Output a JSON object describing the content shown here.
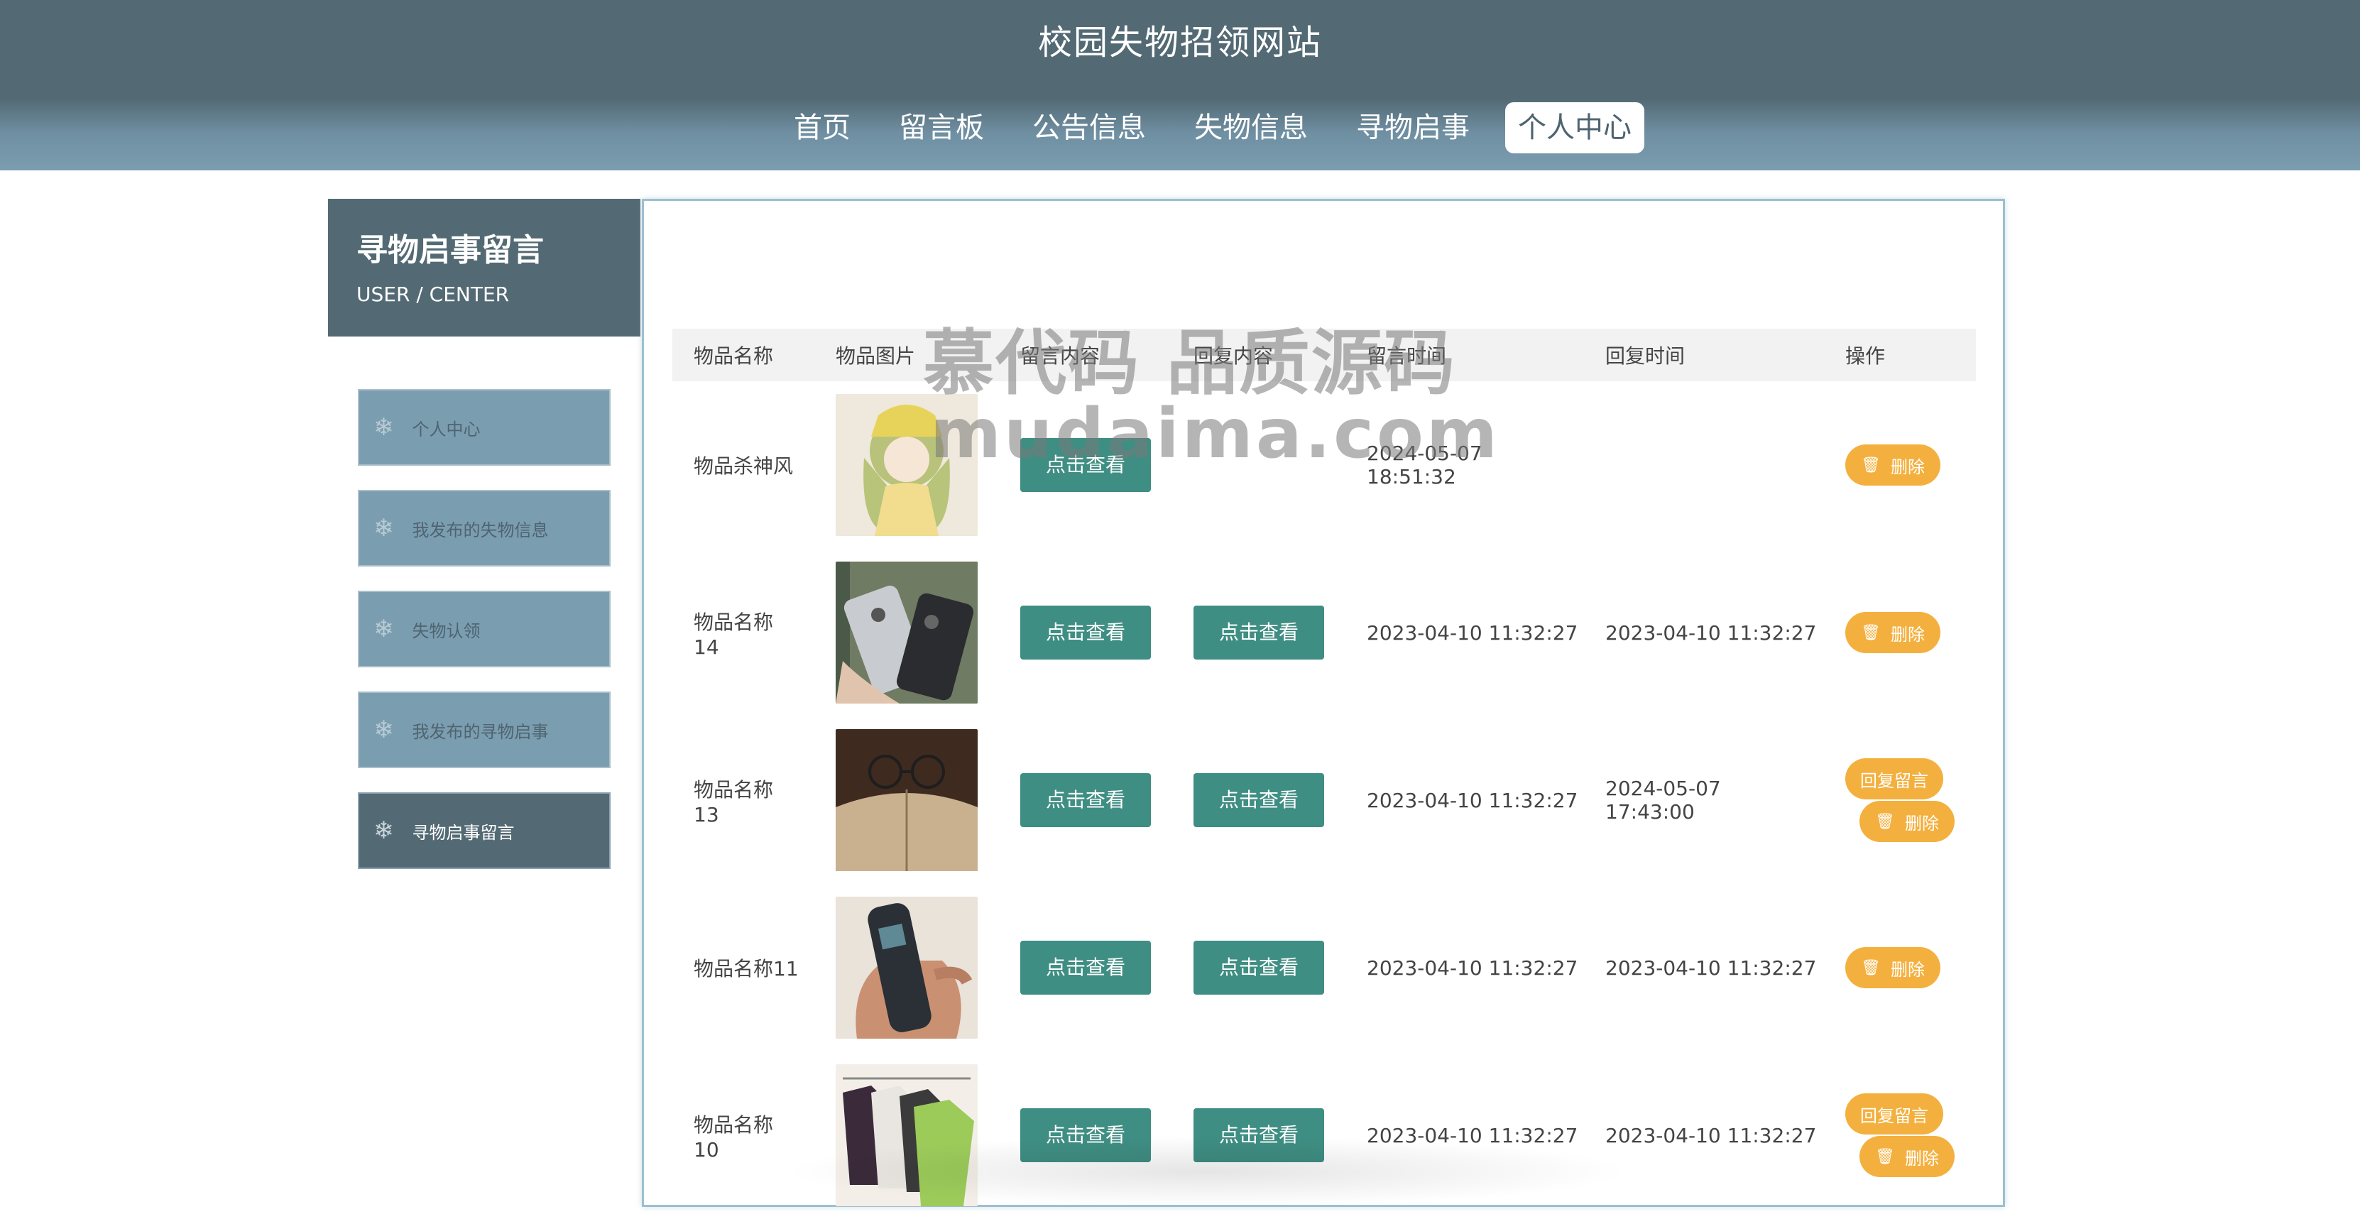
{
  "site": {
    "title": "校园失物招领网站"
  },
  "nav": [
    {
      "label": "首页"
    },
    {
      "label": "留言板"
    },
    {
      "label": "公告信息"
    },
    {
      "label": "失物信息"
    },
    {
      "label": "寻物启事"
    },
    {
      "label": "个人中心",
      "active": true
    }
  ],
  "sidebar": {
    "title": "寻物启事留言",
    "subtitle": "USER / CENTER",
    "items": [
      {
        "label": "个人中心"
      },
      {
        "label": "我发布的失物信息"
      },
      {
        "label": "失物认领"
      },
      {
        "label": "我发布的寻物启事"
      },
      {
        "label": "寻物启事留言",
        "active": true
      }
    ]
  },
  "table": {
    "headers": [
      "物品名称",
      "物品图片",
      "留言内容",
      "回复内容",
      "留言时间",
      "回复时间",
      "操作"
    ],
    "view_label": "点击查看",
    "delete_label": "删除",
    "reply_label": "回复留言",
    "rows": [
      {
        "name": "物品杀神风",
        "image_icon": "doll-photo",
        "has_reply": false,
        "message_time": "2024-05-07 18:51:32",
        "reply_time": "",
        "can_reply": false
      },
      {
        "name": "物品名称14",
        "image_icon": "phones-photo",
        "has_reply": true,
        "message_time": "2023-04-10 11:32:27",
        "reply_time": "2023-04-10 11:32:27",
        "can_reply": false
      },
      {
        "name": "物品名称13",
        "image_icon": "book-glasses-photo",
        "has_reply": true,
        "message_time": "2023-04-10 11:32:27",
        "reply_time": "2024-05-07 17:43:00",
        "can_reply": true
      },
      {
        "name": "物品名称11",
        "image_icon": "old-phone-photo",
        "has_reply": true,
        "message_time": "2023-04-10 11:32:27",
        "reply_time": "2023-04-10 11:32:27",
        "can_reply": false
      },
      {
        "name": "物品名称10",
        "image_icon": "tshirts-photo",
        "has_reply": true,
        "message_time": "2023-04-10 11:32:27",
        "reply_time": "2023-04-10 11:32:27",
        "can_reply": true
      }
    ]
  },
  "watermark": {
    "line1": "慕代码 品质源码",
    "line2": "mudaima.com"
  },
  "colors": {
    "header": "#536a74",
    "accent_teal": "#3f8e83",
    "accent_orange": "#f4b03e",
    "sidebar_item": "#7b9db0"
  }
}
